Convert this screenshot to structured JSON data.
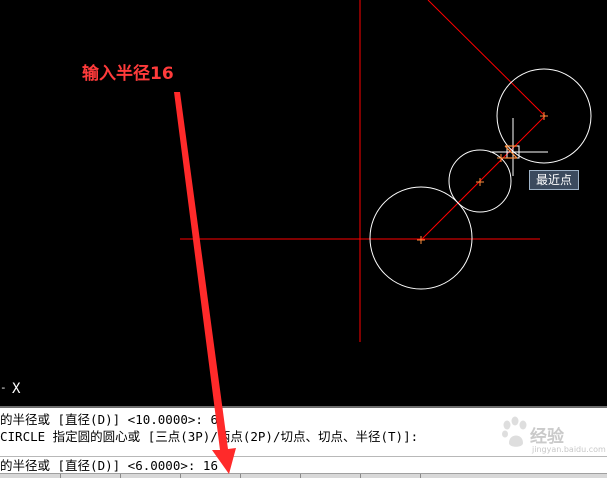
{
  "annotation": {
    "text": "输入半径16",
    "color": "#ff3b3b"
  },
  "tooltip": {
    "text": "最近点"
  },
  "ucs": {
    "axis_label": "X",
    "mark": "-"
  },
  "command_history": {
    "line1": "的半径或 [直径(D)] <10.0000>: 6",
    "line2": " CIRCLE 指定圆的圆心或 [三点(3P)/两点(2P)/切点、切点、半径(T)]:"
  },
  "command_prompt": {
    "text": "的半径或 [直径(D)] <6.0000>: 16"
  },
  "watermark": {
    "text": "经验",
    "sub": "jingyan.baidu.com"
  },
  "colors": {
    "background": "#000000",
    "construction_line": "#ff0000",
    "circle": "#ffffff",
    "center_marker": "#ff8c3a",
    "cursor": "#ffffff",
    "arrow": "#ff2a2a"
  },
  "icons": {
    "crosshair": "crosshair-cursor-icon",
    "center": "center-point-marker-icon",
    "watermark_logo": "paw-logo-icon"
  }
}
